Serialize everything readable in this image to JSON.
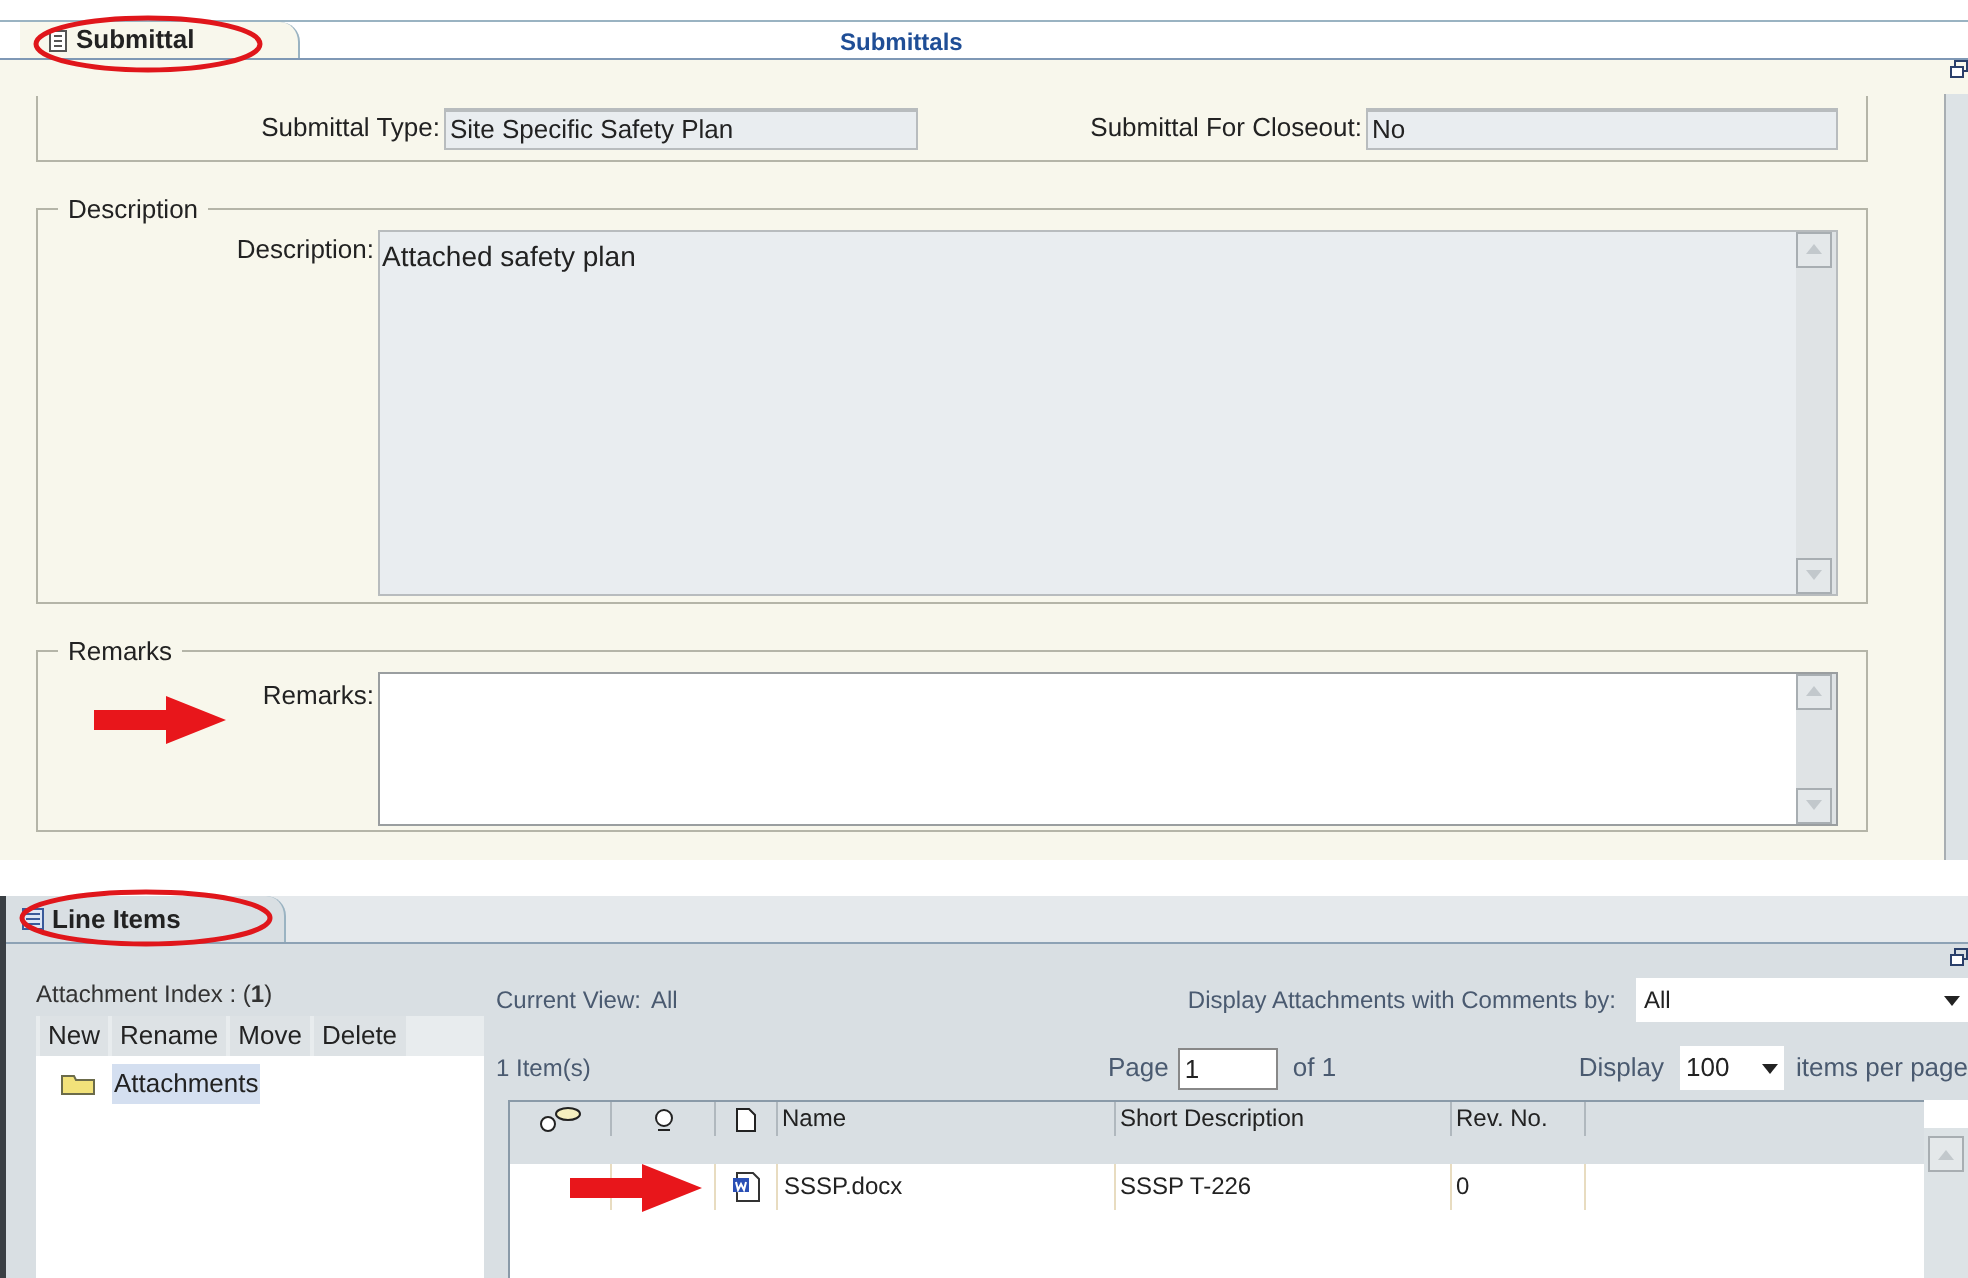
{
  "submittal": {
    "tab": "Submittal",
    "title": "Submittals"
  },
  "fields": [
    {
      "label": "Submittal Type:",
      "value": "Site Specific Safety Plan"
    },
    {
      "label": "Submittal For Closeout:",
      "value": "No"
    }
  ],
  "description": {
    "legend": "Description",
    "label": "Description:",
    "value": "Attached safety plan"
  },
  "remarks": {
    "legend": "Remarks",
    "label": "Remarks:"
  },
  "line_items": {
    "tab": "Line Items",
    "index_label": "Attachment Index : (**1**)",
    "toolbar": [
      "New",
      "Rename",
      "Move",
      "Delete"
    ],
    "tree": [
      {
        "label": "Attachments",
        "selected": true
      }
    ],
    "current_view_label": "Current View:",
    "current_view": "All",
    "comments_filter_label": "Display Attachments with Comments by:",
    "comments_filter": "All",
    "item_count": "1 Item(s)",
    "page_label": "Page",
    "page": "1",
    "page_of": "of 1",
    "display_label": "Display",
    "per_page": "100",
    "per_page_suffix": "items per page",
    "columns": [
      "Name",
      "Short Description",
      "Rev. No."
    ],
    "rows": [
      {
        "name": "SSSP.docx",
        "short_description": "SSSP T-226",
        "rev_no": "0"
      }
    ]
  }
}
